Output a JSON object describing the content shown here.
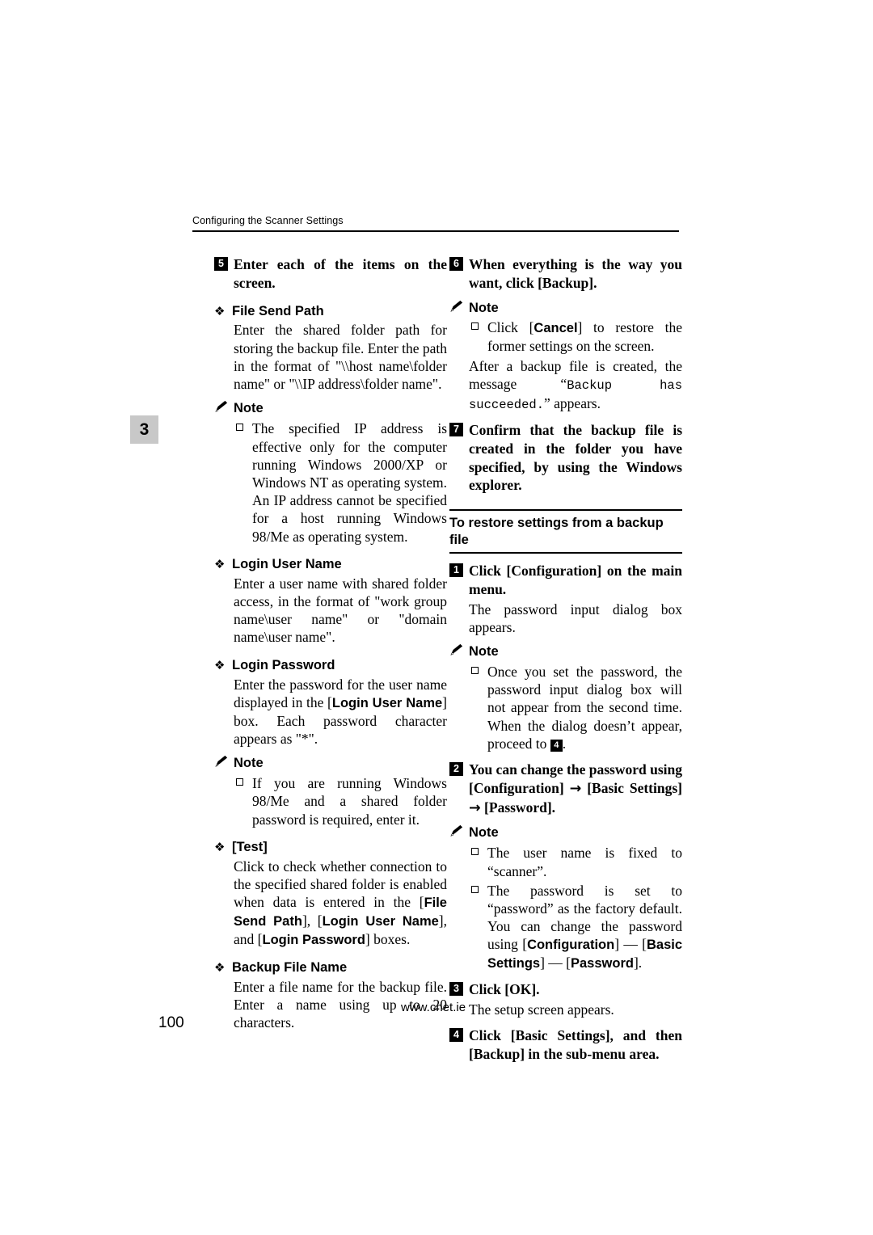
{
  "header": {
    "running_title": "Configuring the Scanner Settings"
  },
  "chapter_tab": "3",
  "page_number": "100",
  "watermark": "www.cnet.ie",
  "left_column": {
    "step5": {
      "num": "5",
      "text": "Enter each of the items on the screen."
    },
    "file_send_path": {
      "heading": "File Send Path",
      "body": "Enter the shared folder path for storing the backup file. Enter the path in the format of \"\\\\host name\\folder name\" or \"\\\\IP address\\folder name\".",
      "note_label": "Note",
      "note_item": "The specified IP address is effective only for the computer running Windows 2000/XP or Windows NT as operating system. An IP address cannot be specified for a host running Windows 98/Me as operating system."
    },
    "login_user_name": {
      "heading": "Login User Name",
      "body": "Enter a user name with shared folder access, in the format of \"work group name\\user name\" or \"domain name\\user name\"."
    },
    "login_password": {
      "heading": "Login Password",
      "body_1": "Enter the password for the user name displayed in the [",
      "body_bold_1": "Login User Name",
      "body_2": "] box. Each password character appears as \"*\".",
      "note_label": "Note",
      "note_item": "If you are running Windows 98/Me and a shared folder password is required, enter it."
    },
    "test": {
      "heading": "[Test]",
      "body_1": "Click to check whether connection to the specified shared folder is enabled when data is entered in the [",
      "body_bold_1": "File Send Path",
      "body_2": "], [",
      "body_bold_2": "Login User Name",
      "body_3": "], and [",
      "body_bold_3": "Login Password",
      "body_4": "] boxes."
    },
    "backup_file_name": {
      "heading": "Backup File Name",
      "body": "Enter a file name for the backup file. Enter a name using up to 20 characters."
    }
  },
  "right_column": {
    "step6": {
      "num": "6",
      "text_1": "When everything is the way you want, click [",
      "text_bold": "Backup",
      "text_2": "].",
      "note_label": "Note",
      "note_item_1": "Click [",
      "note_item_bold": "Cancel",
      "note_item_2": "] to restore the former settings on the screen.",
      "after_text_1": "After a backup file is created, the message “",
      "after_mono": "Backup has succeeded.",
      "after_text_2": "” appears."
    },
    "step7": {
      "num": "7",
      "text": "Confirm that the backup file is created in the folder you have specified, by using the Windows explorer."
    },
    "section_heading": "To restore settings from a backup file",
    "step1": {
      "num": "1",
      "text_1": "Click [",
      "text_bold": "Configuration",
      "text_2": "] on the main menu.",
      "body": "The password input dialog box appears.",
      "note_label": "Note",
      "note_item_1": "Once you set the password, the password input dialog box will not appear from the second time. When the dialog doesn’t appear, proceed to ",
      "note_item_inline_num": "4",
      "note_item_2": "."
    },
    "step2": {
      "num": "2",
      "text_1": "You can change the password using [",
      "text_bold_1": "Configuration",
      "text_mid": "] ",
      "arrow": "→",
      "text_bold_2": "Basic Settings",
      "text_mid2": "] ",
      "text_bold_3": "Password",
      "text_end": "].",
      "note_label": "Note",
      "note_item_1": "The user name is fixed to “scanner”.",
      "note_item_2_a": "The password is set to “password” as the factory default. You can change the password using [",
      "note_item_2_bold_1": "Configuration",
      "note_item_2_dash": "] — [",
      "note_item_2_bold_2": "Basic Settings",
      "note_item_2_dash2": "] — [",
      "note_item_2_bold_3": "Password",
      "note_item_2_end": "]."
    },
    "step3": {
      "num": "3",
      "text_1": "Click [",
      "text_bold": "OK",
      "text_2": "].",
      "body": "The setup screen appears."
    },
    "step4": {
      "num": "4",
      "text_1": "Click [",
      "text_bold_1": "Basic Settings",
      "text_2": "], and then [",
      "text_bold_2": "Backup",
      "text_3": "] in the sub-menu area."
    }
  }
}
